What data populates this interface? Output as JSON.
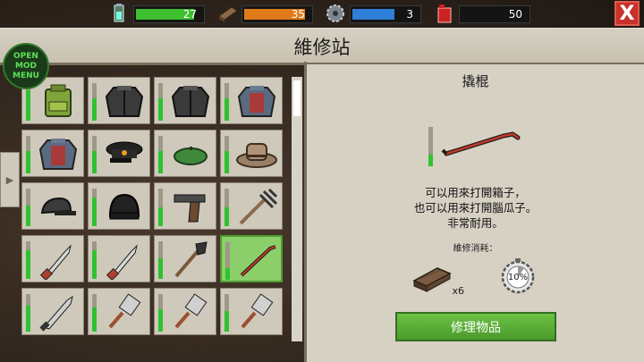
{
  "resources": {
    "energy": {
      "value": "27",
      "icon": "battery-icon",
      "color": "#3fbf2f",
      "level": 0.9
    },
    "wood": {
      "value": "35",
      "icon": "plank-icon",
      "color": "#e07a1a",
      "level": 0.95
    },
    "metal": {
      "value": "3",
      "icon": "gear-icon",
      "color": "#2f7fd8",
      "level": 0.65
    },
    "fuel": {
      "value": "50",
      "icon": "gas-can-icon",
      "color": "#c02020",
      "level": 0.0
    }
  },
  "close_label": "X",
  "title": "維修站",
  "mod_menu": {
    "line1": "OPEN",
    "line2": "MOD MENU"
  },
  "side_tab": "▶",
  "slots": [
    {
      "icon": "backpack-icon",
      "durability": 0.8
    },
    {
      "icon": "black-jacket-icon",
      "durability": 0.6
    },
    {
      "icon": "black-jacket-icon",
      "durability": 0.6
    },
    {
      "icon": "red-jacket-icon",
      "durability": 0.6
    },
    {
      "icon": "red-jacket-icon",
      "durability": 0.6
    },
    {
      "icon": "officer-cap-icon",
      "durability": 0.6
    },
    {
      "icon": "beret-icon",
      "durability": 0.6
    },
    {
      "icon": "cowboy-hat-icon",
      "durability": 0.6
    },
    {
      "icon": "cap-icon",
      "durability": 0.55
    },
    {
      "icon": "beanie-icon",
      "durability": 0.75
    },
    {
      "icon": "pistol-icon",
      "durability": 0.5
    },
    {
      "icon": "pitchfork-icon",
      "durability": 0.5
    },
    {
      "icon": "knife-icon",
      "durability": 0.75
    },
    {
      "icon": "knife-icon",
      "durability": 0.75
    },
    {
      "icon": "shovel-icon",
      "durability": 0.55
    },
    {
      "icon": "crowbar-icon",
      "durability": 0.3
    },
    {
      "icon": "machete-icon",
      "durability": 0.7
    },
    {
      "icon": "cleaver-icon",
      "durability": 0.65
    },
    {
      "icon": "cleaver-icon",
      "durability": 0.6
    },
    {
      "icon": "cleaver-icon",
      "durability": 0.55
    }
  ],
  "selected_slot": 15,
  "detail": {
    "name": "撬棍",
    "icon": "crowbar-icon",
    "durability": 0.3,
    "description": [
      "可以用來打開箱子，",
      "也可以用來打開腦瓜子。",
      "非常耐用。"
    ],
    "cost_label": "維修消耗：",
    "cost_wood_count": "x6",
    "cost_gear_percent": "10%",
    "repair_button": "修理物品"
  }
}
